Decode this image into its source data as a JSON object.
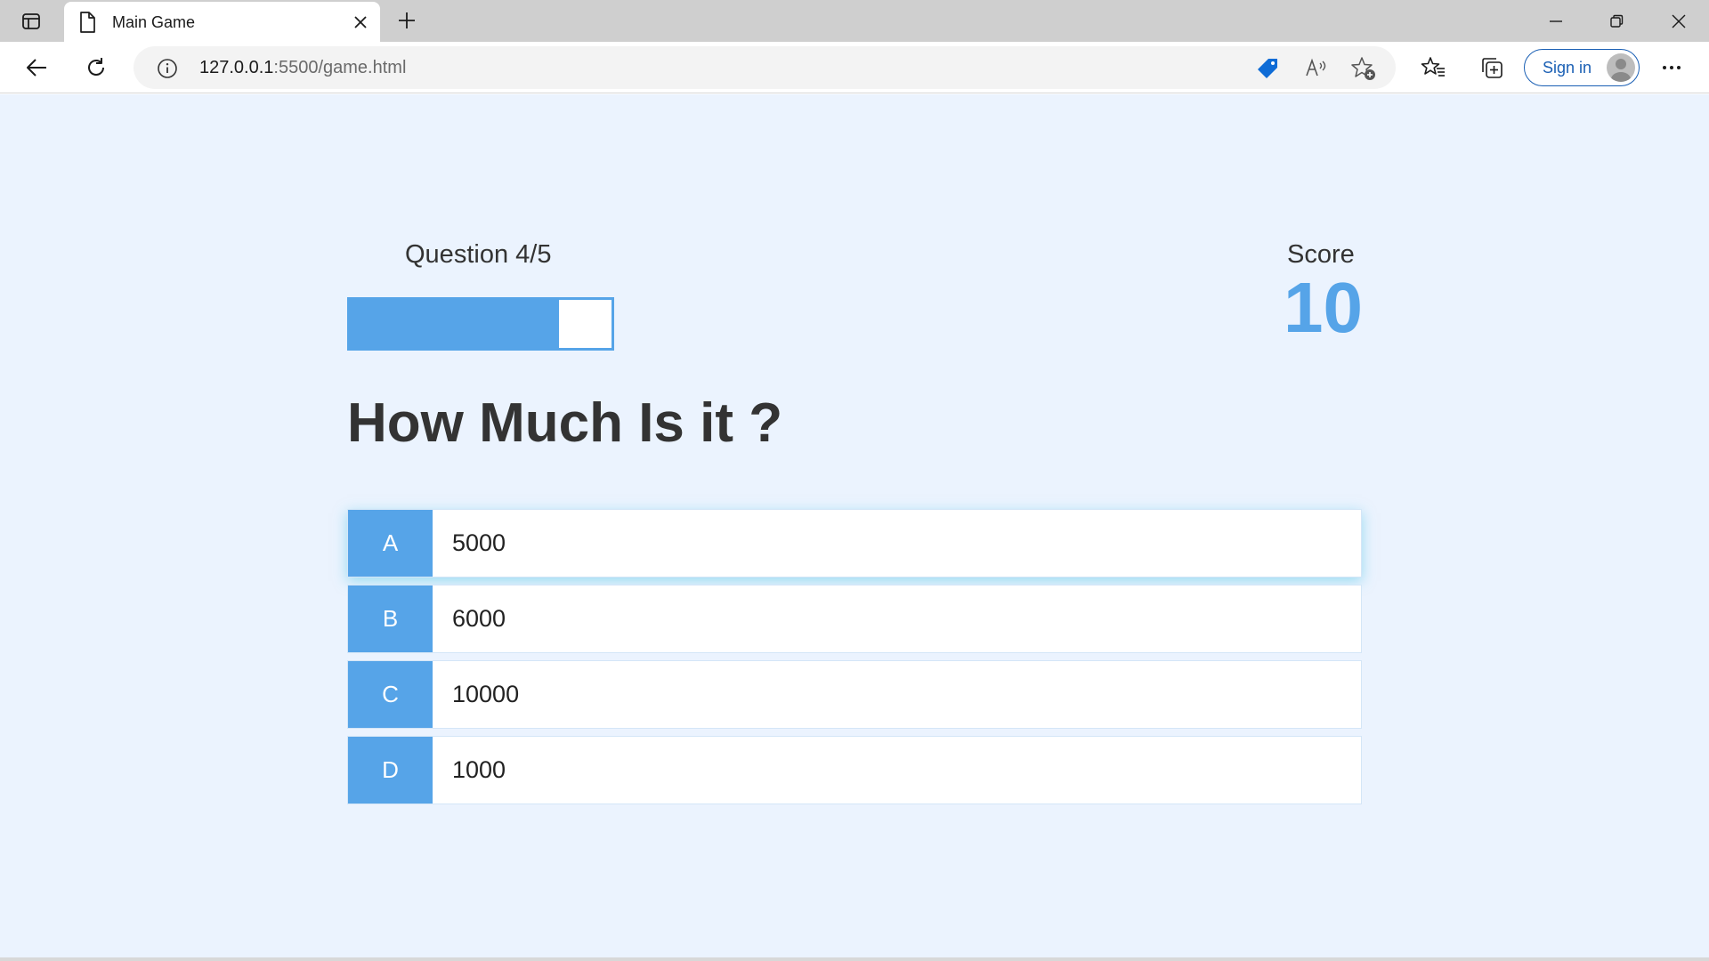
{
  "browser": {
    "tab": {
      "title": "Main Game"
    },
    "address": {
      "host": "127.0.0.1",
      "rest": ":5500/game.html"
    },
    "signin_label": "Sign in"
  },
  "game": {
    "question_label": "Question 4/5",
    "progress_fraction": 0.8,
    "score_label": "Score",
    "score_value": "10",
    "question": "How Much Is it ?",
    "choices": [
      {
        "prefix": "A",
        "text": "5000"
      },
      {
        "prefix": "B",
        "text": "6000"
      },
      {
        "prefix": "C",
        "text": "10000"
      },
      {
        "prefix": "D",
        "text": "1000"
      }
    ]
  },
  "colors": {
    "accent": "#56a4e8",
    "page_background": "#ebf3fe",
    "text": "#333333"
  }
}
